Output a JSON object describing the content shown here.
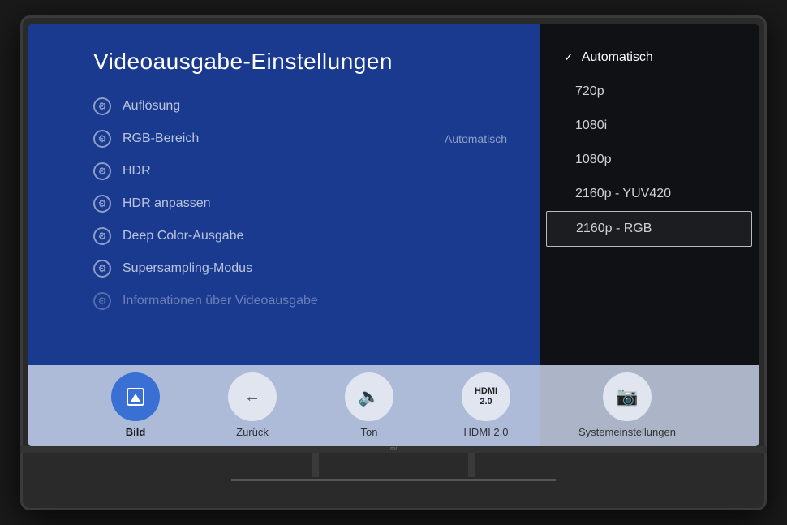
{
  "tv": {
    "screen": {
      "title": "Videoausgabe-Einstellungen",
      "menu_items": [
        {
          "id": "aufloesung",
          "label": "Auflösung",
          "value": ""
        },
        {
          "id": "rgb-bereich",
          "label": "RGB-Bereich",
          "value": "Automatisch"
        },
        {
          "id": "hdr",
          "label": "HDR",
          "value": ""
        },
        {
          "id": "hdr-anpassen",
          "label": "HDR anpassen",
          "value": ""
        },
        {
          "id": "deep-color",
          "label": "Deep Color-Ausgabe",
          "value": ""
        },
        {
          "id": "supersampling",
          "label": "Supersampling-Modus",
          "value": ""
        },
        {
          "id": "info",
          "label": "Informationen über Videoausgabe",
          "value": ""
        }
      ],
      "dropdown": {
        "options": [
          {
            "id": "automatisch",
            "label": "Automatisch",
            "selected": true,
            "highlighted": false
          },
          {
            "id": "720p",
            "label": "720p",
            "selected": false,
            "highlighted": false
          },
          {
            "id": "1080i",
            "label": "1080i",
            "selected": false,
            "highlighted": false
          },
          {
            "id": "1080p",
            "label": "1080p",
            "selected": false,
            "highlighted": false
          },
          {
            "id": "2160p-yuv420",
            "label": "2160p - YUV420",
            "selected": false,
            "highlighted": false
          },
          {
            "id": "2160p-rgb",
            "label": "2160p - RGB",
            "selected": false,
            "highlighted": true
          }
        ]
      }
    },
    "bottom_bar": {
      "items": [
        {
          "id": "bild",
          "label": "Bild",
          "icon": "bookmark",
          "active": true
        },
        {
          "id": "zurueck",
          "label": "Zurück",
          "icon": "back",
          "active": false
        },
        {
          "id": "ton",
          "label": "Ton",
          "icon": "speaker",
          "active": false
        },
        {
          "id": "hdmi",
          "label": "HDMI 2.0",
          "icon": "hdmi",
          "active": false
        },
        {
          "id": "system",
          "label": "Systemeinstellungen",
          "icon": "camera",
          "active": false
        }
      ]
    }
  }
}
